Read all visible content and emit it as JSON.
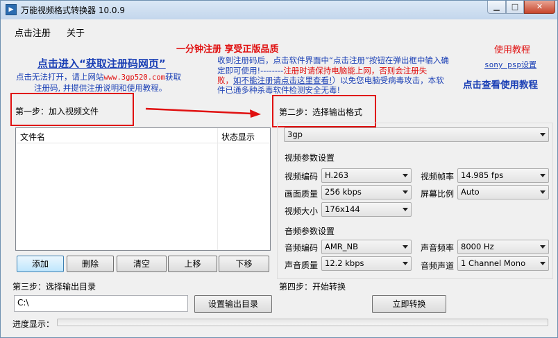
{
  "window": {
    "title": "万能视频格式转换器 10.0.9",
    "icon": "app-icon"
  },
  "menu": {
    "register": "点击注册",
    "about": "关于"
  },
  "promo": {
    "headline": "一分钟注册  享受正版品质",
    "get_code_link": "点击进入“获取注册码网页”",
    "fallback_pre": "点击无法打开，请上网站",
    "fallback_site": "www.3gp520.com",
    "fallback_post1": "获取",
    "fallback_post2": "注册码, 并提供注册说明和使用教程。",
    "reg_note_1": "收到注册码后，点击软件界面中“点击注册”按钮在弹出框中输入确",
    "reg_note_2a": "定即可使用!--------",
    "reg_note_2b": "注册时请保持电脑能上网，否则会注册失",
    "reg_note_3a": "败，",
    "reg_note_3b": "如不能注册请点击这里查看!",
    "reg_note_3c": "）以免您电脑受病毒攻击，本软",
    "reg_note_4": "件已通多种杀毒软件检测安全无毒!",
    "tutorial_title": "使用教程",
    "psp_link": "sony psp设置",
    "tutorial_link": "点击查看使用教程"
  },
  "step1": {
    "label": "第一步：加入视频文件",
    "columns": [
      "文件名",
      "状态显示"
    ],
    "buttons": {
      "add": "添加",
      "delete": "删除",
      "clear": "清空",
      "up": "上移",
      "down": "下移"
    }
  },
  "step2": {
    "label": "第二步：选择输出格式",
    "format": "3gp",
    "video_group": "视频参数设置",
    "audio_group": "音频参数设置",
    "video": {
      "codec_label": "视频编码",
      "codec": "H.263",
      "fps_label": "视频帧率",
      "fps": "14.985 fps",
      "quality_label": "画面质量",
      "quality": "256 kbps",
      "ratio_label": "屏幕比例",
      "ratio": "Auto",
      "size_label": "视频大小",
      "size": "176x144"
    },
    "audio": {
      "codec_label": "音频编码",
      "codec": "AMR_NB",
      "rate_label": "声音频率",
      "rate": "8000 Hz",
      "quality_label": "声音质量",
      "quality": "12.2 kbps",
      "channel_label": "音频声道",
      "channel": "1 Channel Mono"
    }
  },
  "step3": {
    "label": "第三步：选择输出目录",
    "path": "C:\\",
    "button": "设置输出目录"
  },
  "step4": {
    "label": "第四步：开始转换",
    "button": "立即转换"
  },
  "progress": {
    "label": "进度显示：",
    "value": 0
  },
  "colors": {
    "highlight_red": "#e01010",
    "link_blue": "#1a3fb5"
  }
}
